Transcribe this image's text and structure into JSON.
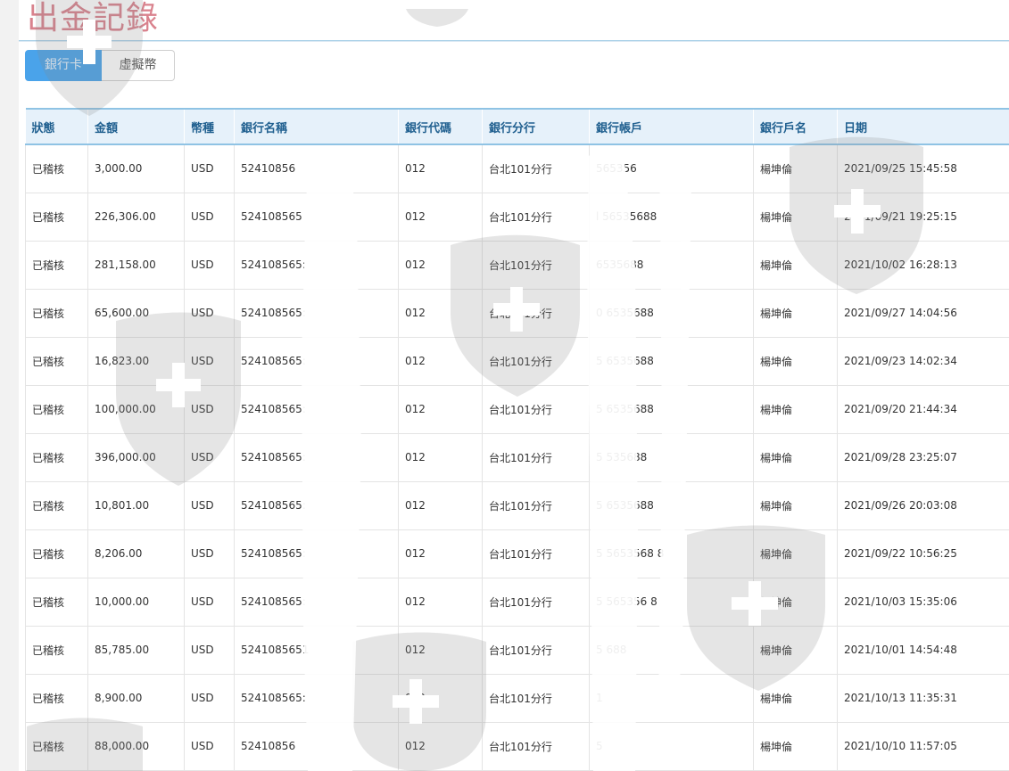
{
  "page": {
    "title": "出金記錄"
  },
  "tabs": [
    {
      "label": "銀行卡",
      "active": true
    },
    {
      "label": "虛擬幣",
      "active": false
    }
  ],
  "table": {
    "columns": [
      "狀態",
      "金額",
      "幣種",
      "銀行名稱",
      "銀行代碼",
      "銀行分行",
      "銀行帳戶",
      "銀行戶名",
      "日期"
    ],
    "rows": [
      {
        "status": "已稽核",
        "amount": "3,000.00",
        "currency": "USD",
        "bank_name": "52410856",
        "bank_code": "012",
        "branch": "台北101分行",
        "account": "565356",
        "holder": "楊坤倫",
        "date": "2021/09/25 15:45:58"
      },
      {
        "status": "已稽核",
        "amount": "226,306.00",
        "currency": "USD",
        "bank_name": "524108565",
        "bank_code": "012",
        "branch": "台北101分行",
        "account": "l 56535688",
        "holder": "楊坤倫",
        "date": "2021/09/21 19:25:15"
      },
      {
        "status": "已稽核",
        "amount": "281,158.00",
        "currency": "USD",
        "bank_name": "524108565:",
        "bank_code": "012",
        "branch": "台北101分行",
        "account": "6535688",
        "holder": "楊坤倫",
        "date": "2021/10/02 16:28:13"
      },
      {
        "status": "已稽核",
        "amount": "65,600.00",
        "currency": "USD",
        "bank_name": "524108565:",
        "bank_code": "012",
        "branch": "台北101分行",
        "account": "0 6535688",
        "holder": "楊坤倫",
        "date": "2021/09/27 14:04:56"
      },
      {
        "status": "已稽核",
        "amount": "16,823.00",
        "currency": "USD",
        "bank_name": "524108565:",
        "bank_code": "012",
        "branch": "台北101分行",
        "account": "5 6535688",
        "holder": "楊坤倫",
        "date": "2021/09/23 14:02:34"
      },
      {
        "status": "已稽核",
        "amount": "100,000.00",
        "currency": "USD",
        "bank_name": "524108565:",
        "bank_code": "012",
        "branch": "台北101分行",
        "account": "5 6535688",
        "holder": "楊坤倫",
        "date": "2021/09/20 21:44:34"
      },
      {
        "status": "已稽核",
        "amount": "396,000.00",
        "currency": "USD",
        "bank_name": "524108565:",
        "bank_code": "012",
        "branch": "台北101分行",
        "account": "5 535688",
        "holder": "楊坤倫",
        "date": "2021/09/28 23:25:07"
      },
      {
        "status": "已稽核",
        "amount": "10,801.00",
        "currency": "USD",
        "bank_name": "524108565:",
        "bank_code": "012",
        "branch": "台北101分行",
        "account": "5 6535688",
        "holder": "楊坤倫",
        "date": "2021/09/26 20:03:08"
      },
      {
        "status": "已稽核",
        "amount": "8,206.00",
        "currency": "USD",
        "bank_name": "524108565:",
        "bank_code": "012",
        "branch": "台北101分行",
        "account": "5 5653568 8",
        "holder": "楊坤倫",
        "date": "2021/09/22 10:56:25"
      },
      {
        "status": "已稽核",
        "amount": "10,000.00",
        "currency": "USD",
        "bank_name": "524108565:",
        "bank_code": "012",
        "branch": "台北101分行",
        "account": "5 565356 8",
        "holder": "楊坤倫",
        "date": "2021/10/03 15:35:06"
      },
      {
        "status": "已稽核",
        "amount": "85,785.00",
        "currency": "USD",
        "bank_name": "5241085651",
        "bank_code": "012",
        "branch": "台北101分行",
        "account": "5 688",
        "holder": "楊坤倫",
        "date": "2021/10/01 14:54:48"
      },
      {
        "status": "已稽核",
        "amount": "8,900.00",
        "currency": "USD",
        "bank_name": "524108565:",
        "bank_code": "012",
        "branch": "台北101分行",
        "account": "1",
        "holder": "楊坤倫",
        "date": "2021/10/13 11:35:31"
      },
      {
        "status": "已稽核",
        "amount": "88,000.00",
        "currency": "USD",
        "bank_name": "52410856",
        "bank_code": "012",
        "branch": "台北101分行",
        "account": "5",
        "holder": "楊坤倫",
        "date": "2021/10/10 11:57:05"
      }
    ]
  },
  "colors": {
    "title": "#d9828d",
    "tab_active": "#4aa3ea",
    "header_bg": "#e6f1fa",
    "header_text": "#1f5f8f",
    "header_rule": "#8fc3e4"
  }
}
